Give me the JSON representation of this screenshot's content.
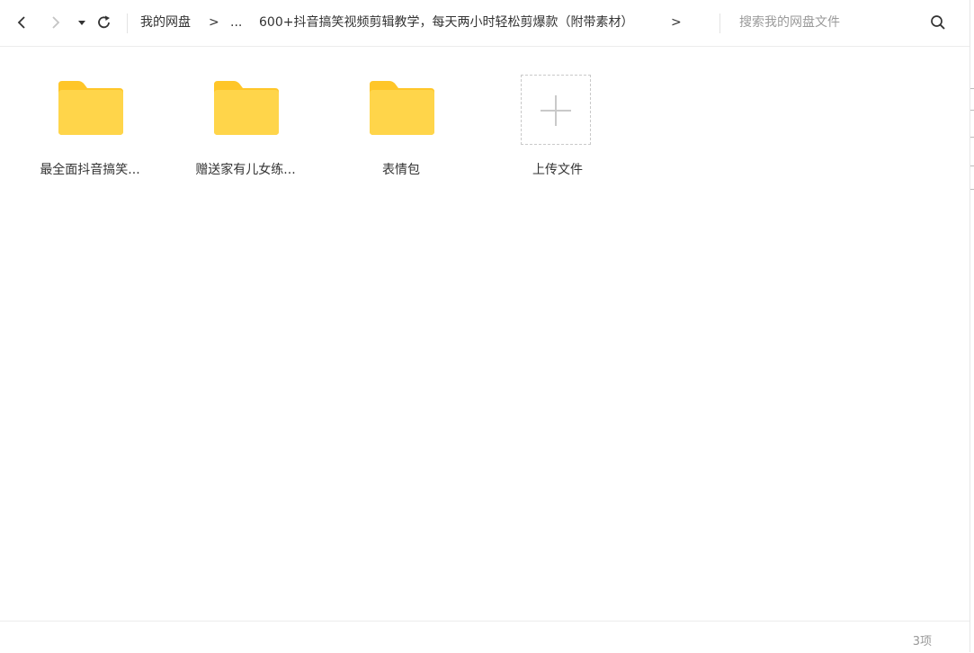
{
  "toolbar": {
    "back_icon": "chevron-left-icon",
    "forward_icon": "chevron-right-icon",
    "history_icon": "caret-down-icon",
    "refresh_icon": "refresh-icon",
    "breadcrumb": {
      "root": "我的网盘",
      "sep1": ">",
      "ellipsis": "...",
      "current": "600+抖音搞笑视频剪辑教学，每天两小时轻松剪爆款（附带素材）",
      "sep2": ">"
    },
    "search_placeholder": "搜索我的网盘文件",
    "search_icon": "search-icon"
  },
  "items": [
    {
      "type": "folder",
      "label": "最全面抖音搞笑..."
    },
    {
      "type": "folder",
      "label": "赠送家有儿女练..."
    },
    {
      "type": "folder",
      "label": "表情包"
    },
    {
      "type": "upload",
      "label": "上传文件"
    }
  ],
  "footer": {
    "count": "3项"
  },
  "colors": {
    "folder": "#FFD54A",
    "folder_tab": "#FFC629",
    "dashed": "#C9C9C9"
  }
}
